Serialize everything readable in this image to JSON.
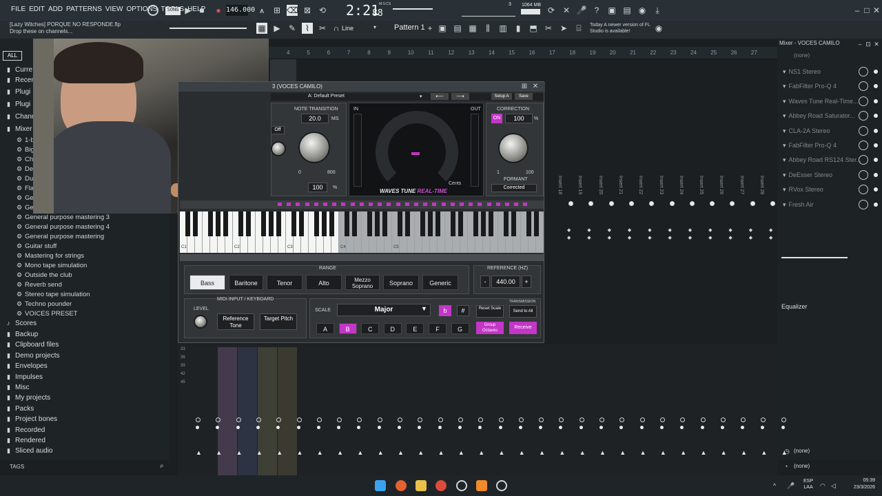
{
  "menu": [
    "FILE",
    "EDIT",
    "ADD",
    "PATTERNS",
    "VIEW",
    "OPTIONS",
    "TOOLS",
    "HELP"
  ],
  "transport": {
    "mode": "SONG",
    "tempo": "146.000",
    "time": "2:21",
    "time_small": "88",
    "time_unit": "M:S:CS",
    "memory": "1064 MB",
    "cpu": "3"
  },
  "hint": {
    "line1": "[Lazy Witches] PORQUE NO RESPONDE.flp",
    "line2": "Drop these on channels..."
  },
  "news": {
    "day": "Today",
    "text": "A newer version of FL Studio is available!"
  },
  "toolbar2": {
    "snap": "Line",
    "pattern": "Pattern 1"
  },
  "browser": {
    "all_tab": "ALL",
    "top_items": [
      "Curre",
      "Recen",
      "Plugi",
      "Plugi",
      "Chann",
      "Mixer"
    ],
    "sub_items": [
      "1-b",
      "Big",
      "Cho",
      "Def",
      "Dua",
      "Fla",
      "Gen",
      "Gen",
      "General purpose mastering 3",
      "General purpose mastering 4",
      "General purpose mastering",
      "Guitar stuff",
      "Mastering for strings",
      "Mono tape simulation",
      "Outside the club",
      "Reverb send",
      "Stereo tape simulation",
      "Techno pounder",
      "VOICES PRESET"
    ],
    "folders": [
      "Scores",
      "Backup",
      "Clipboard files",
      "Demo projects",
      "Envelopes",
      "Impulses",
      "Misc",
      "My projects",
      "Packs",
      "Project bones",
      "Recorded",
      "Rendered",
      "Sliced audio"
    ],
    "tags": "TAGS"
  },
  "plugin": {
    "window_title": "3 (VOCES CAMILO)",
    "preset": "A: Default Preset",
    "setup": "Setup A",
    "save": "Save",
    "note_transition": "NOTE TRANSITION",
    "nt_value": "20.0",
    "nt_unit": "ms",
    "nt_min": "0",
    "nt_max": "800",
    "speed_value": "100",
    "speed_unit": "%",
    "off": "Off",
    "in": "IN",
    "out": "OUT",
    "brand": "WAVES TUNE",
    "brand2": "REAL-TIME",
    "cents": "Cents",
    "correction": "CORRECTION",
    "on": "ON",
    "corr_value": "100",
    "corr_unit": "%",
    "corr_min": "1",
    "corr_max": "100",
    "formant": "FORMANT",
    "corrected": "Corrected",
    "octaves": [
      "C1",
      "C2",
      "C3",
      "C4",
      "C5"
    ],
    "range_title": "RANGE",
    "ranges": [
      "Bass",
      "Baritone",
      "Tenor",
      "Alto",
      "Mezzo Soprano",
      "Soprano",
      "Generic"
    ],
    "ref_title": "REFERENCE (Hz)",
    "ref_value": "440.00",
    "midi_title": "MIDI INPUT / KEYBOARD",
    "level": "LEVEL",
    "ref_tone": "Reference Tone",
    "target_pitch": "Target Pitch",
    "scale_label": "SCALE",
    "scale": "Major",
    "flat": "b",
    "sharp": "#",
    "reset_scale": "Reset Scale",
    "transmission": "TRANSMISSION",
    "send_all": "Send to All",
    "group_oct": "Group Octaves",
    "receive": "Receive",
    "notes": [
      "A",
      "B",
      "C",
      "D",
      "E",
      "F",
      "G"
    ]
  },
  "playlist": {
    "bars": [
      "4",
      "5",
      "6",
      "7",
      "8",
      "9",
      "10",
      "11",
      "12",
      "13",
      "14",
      "15",
      "16",
      "17",
      "18",
      "19",
      "20",
      "21",
      "22",
      "23",
      "24",
      "25",
      "26",
      "27"
    ]
  },
  "inserts": [
    "Insert 18",
    "Insert 19",
    "Insert 20",
    "Insert 21",
    "Insert 22",
    "Insert 23",
    "Insert 24",
    "Insert 25",
    "Insert 26",
    "Insert 27",
    "Insert 28"
  ],
  "mixer": {
    "title": "Mixer - VOCES CAMILO",
    "in": "(none)",
    "slots": [
      "NS1 Stereo",
      "FabFilter Pro-Q 4",
      "Waves Tune Real-Time...",
      "Abbey Road Saturator...",
      "CLA-2A Stereo",
      "FabFilter Pro-Q 4",
      "Abbey Road RS124 Ster...",
      "DeEsser Stereo",
      "RVox Stereo",
      "Fresh Air"
    ],
    "eq": "Equalizer",
    "out1": "(none)",
    "out2": "(none)"
  },
  "levels": [
    "33",
    "36",
    "39",
    "42",
    "45"
  ],
  "taskbar": {
    "lang": "ESP",
    "lang2": "LAA",
    "time": "05:39",
    "date": "23/3/2026"
  }
}
